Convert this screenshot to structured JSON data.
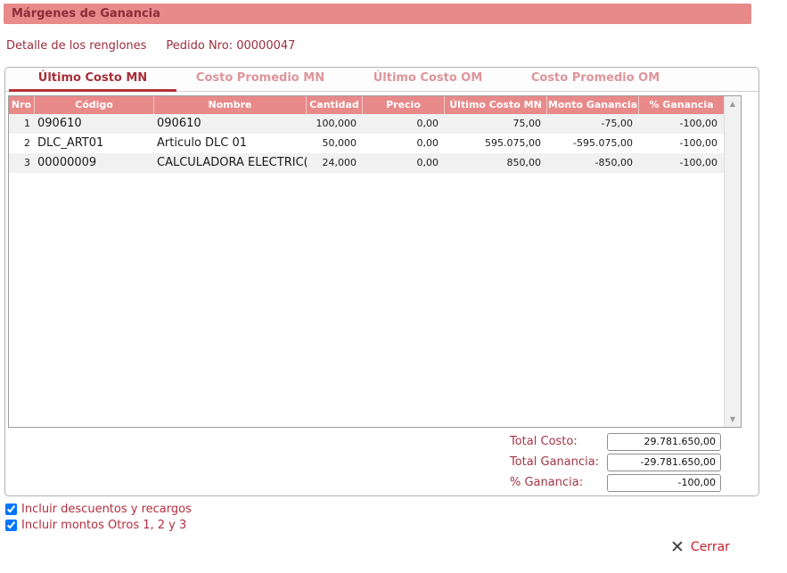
{
  "window": {
    "title": "Márgenes de Ganancia"
  },
  "subheader": {
    "detail_label": "Detalle de los renglones",
    "order_label": "Pedido Nro: 00000047"
  },
  "tabs": [
    {
      "label": "Último Costo MN",
      "active": true
    },
    {
      "label": "Costo Promedio MN",
      "active": false
    },
    {
      "label": "Último Costo OM",
      "active": false
    },
    {
      "label": "Costo Promedio OM",
      "active": false
    }
  ],
  "table": {
    "columns": [
      "Nro",
      "Código",
      "Nombre",
      "Cantidad",
      "Precio",
      "Último Costo MN",
      "Monto Ganancia",
      "% Ganancia"
    ],
    "rows": [
      {
        "nro": "1",
        "codigo": "090610",
        "nombre": "090610",
        "cantidad": "100,000",
        "precio": "0,00",
        "ultimo_costo_mn": "75,00",
        "monto_ganancia": "-75,00",
        "pct_ganancia": "-100,00"
      },
      {
        "nro": "2",
        "codigo": "DLC_ART01",
        "nombre": "Articulo DLC 01",
        "cantidad": "50,000",
        "precio": "0,00",
        "ultimo_costo_mn": "595.075,00",
        "monto_ganancia": "-595.075,00",
        "pct_ganancia": "-100,00"
      },
      {
        "nro": "3",
        "codigo": "00000009",
        "nombre": "CALCULADORA ELECTRIC(",
        "cantidad": "24,000",
        "precio": "0,00",
        "ultimo_costo_mn": "850,00",
        "monto_ganancia": "-850,00",
        "pct_ganancia": "-100,00"
      }
    ]
  },
  "scrollbar": {
    "up_icon": "▲",
    "down_icon": "▼"
  },
  "totals": {
    "total_costo": {
      "label": "Total Costo:",
      "value": "29.781.650,00"
    },
    "total_ganancia": {
      "label": "Total Ganancia:",
      "value": "-29.781.650,00"
    },
    "pct_ganancia": {
      "label": "% Ganancia:",
      "value": "-100,00"
    }
  },
  "options": [
    {
      "label": "Incluir descuentos y recargos",
      "checked": true
    },
    {
      "label": "Incluir montos Otros 1, 2 y 3",
      "checked": true
    }
  ],
  "footer": {
    "close_icon": "✕",
    "close_label": "Cerrar"
  },
  "colors": {
    "accent_salmon": "#e8898a",
    "maroon_text": "#9c2d3e",
    "active_tab_underline": "#b5303a",
    "inactive_tab_text": "#de949c",
    "close_red": "#c5202e",
    "row_stripe": "#f1f1f1"
  }
}
